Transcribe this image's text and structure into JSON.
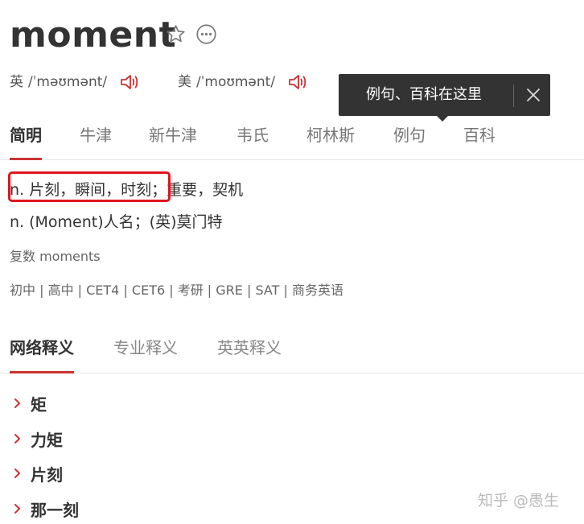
{
  "header": {
    "word": "moment",
    "favorite_icon": "star-icon",
    "more_icon": "more-dots-icon"
  },
  "pronunciations": {
    "uk": {
      "lang": "英",
      "phonetic": "/ˈməʊmənt/",
      "icon": "speaker-icon"
    },
    "us": {
      "lang": "美",
      "phonetic": "/ˈmoʊmənt/",
      "icon": "speaker-icon"
    }
  },
  "tooltip": {
    "text": "例句、百科在这里",
    "close_icon": "close-icon"
  },
  "dict_tabs": [
    "简明",
    "牛津",
    "新牛津",
    "韦氏",
    "柯林斯",
    "例句",
    "百科"
  ],
  "definitions": {
    "line1_highlighted": "n. 片刻，瞬间，时刻；",
    "line1_rest": "重要，契机",
    "line2": "n. (Moment)人名；(英)莫门特",
    "plural": "复数 moments",
    "exams": "初中 | 高中 | CET4 | CET6 | 考研 | GRE | SAT | 商务英语"
  },
  "meaning_tabs": [
    "网络释义",
    "专业释义",
    "英英释义"
  ],
  "net_meanings": [
    "矩",
    "力矩",
    "片刻",
    "那一刻"
  ],
  "watermark": "知乎 @愚生",
  "colors": {
    "accent": "#c33",
    "highlight_border": "#e0161e",
    "tooltip_bg": "#333333"
  }
}
